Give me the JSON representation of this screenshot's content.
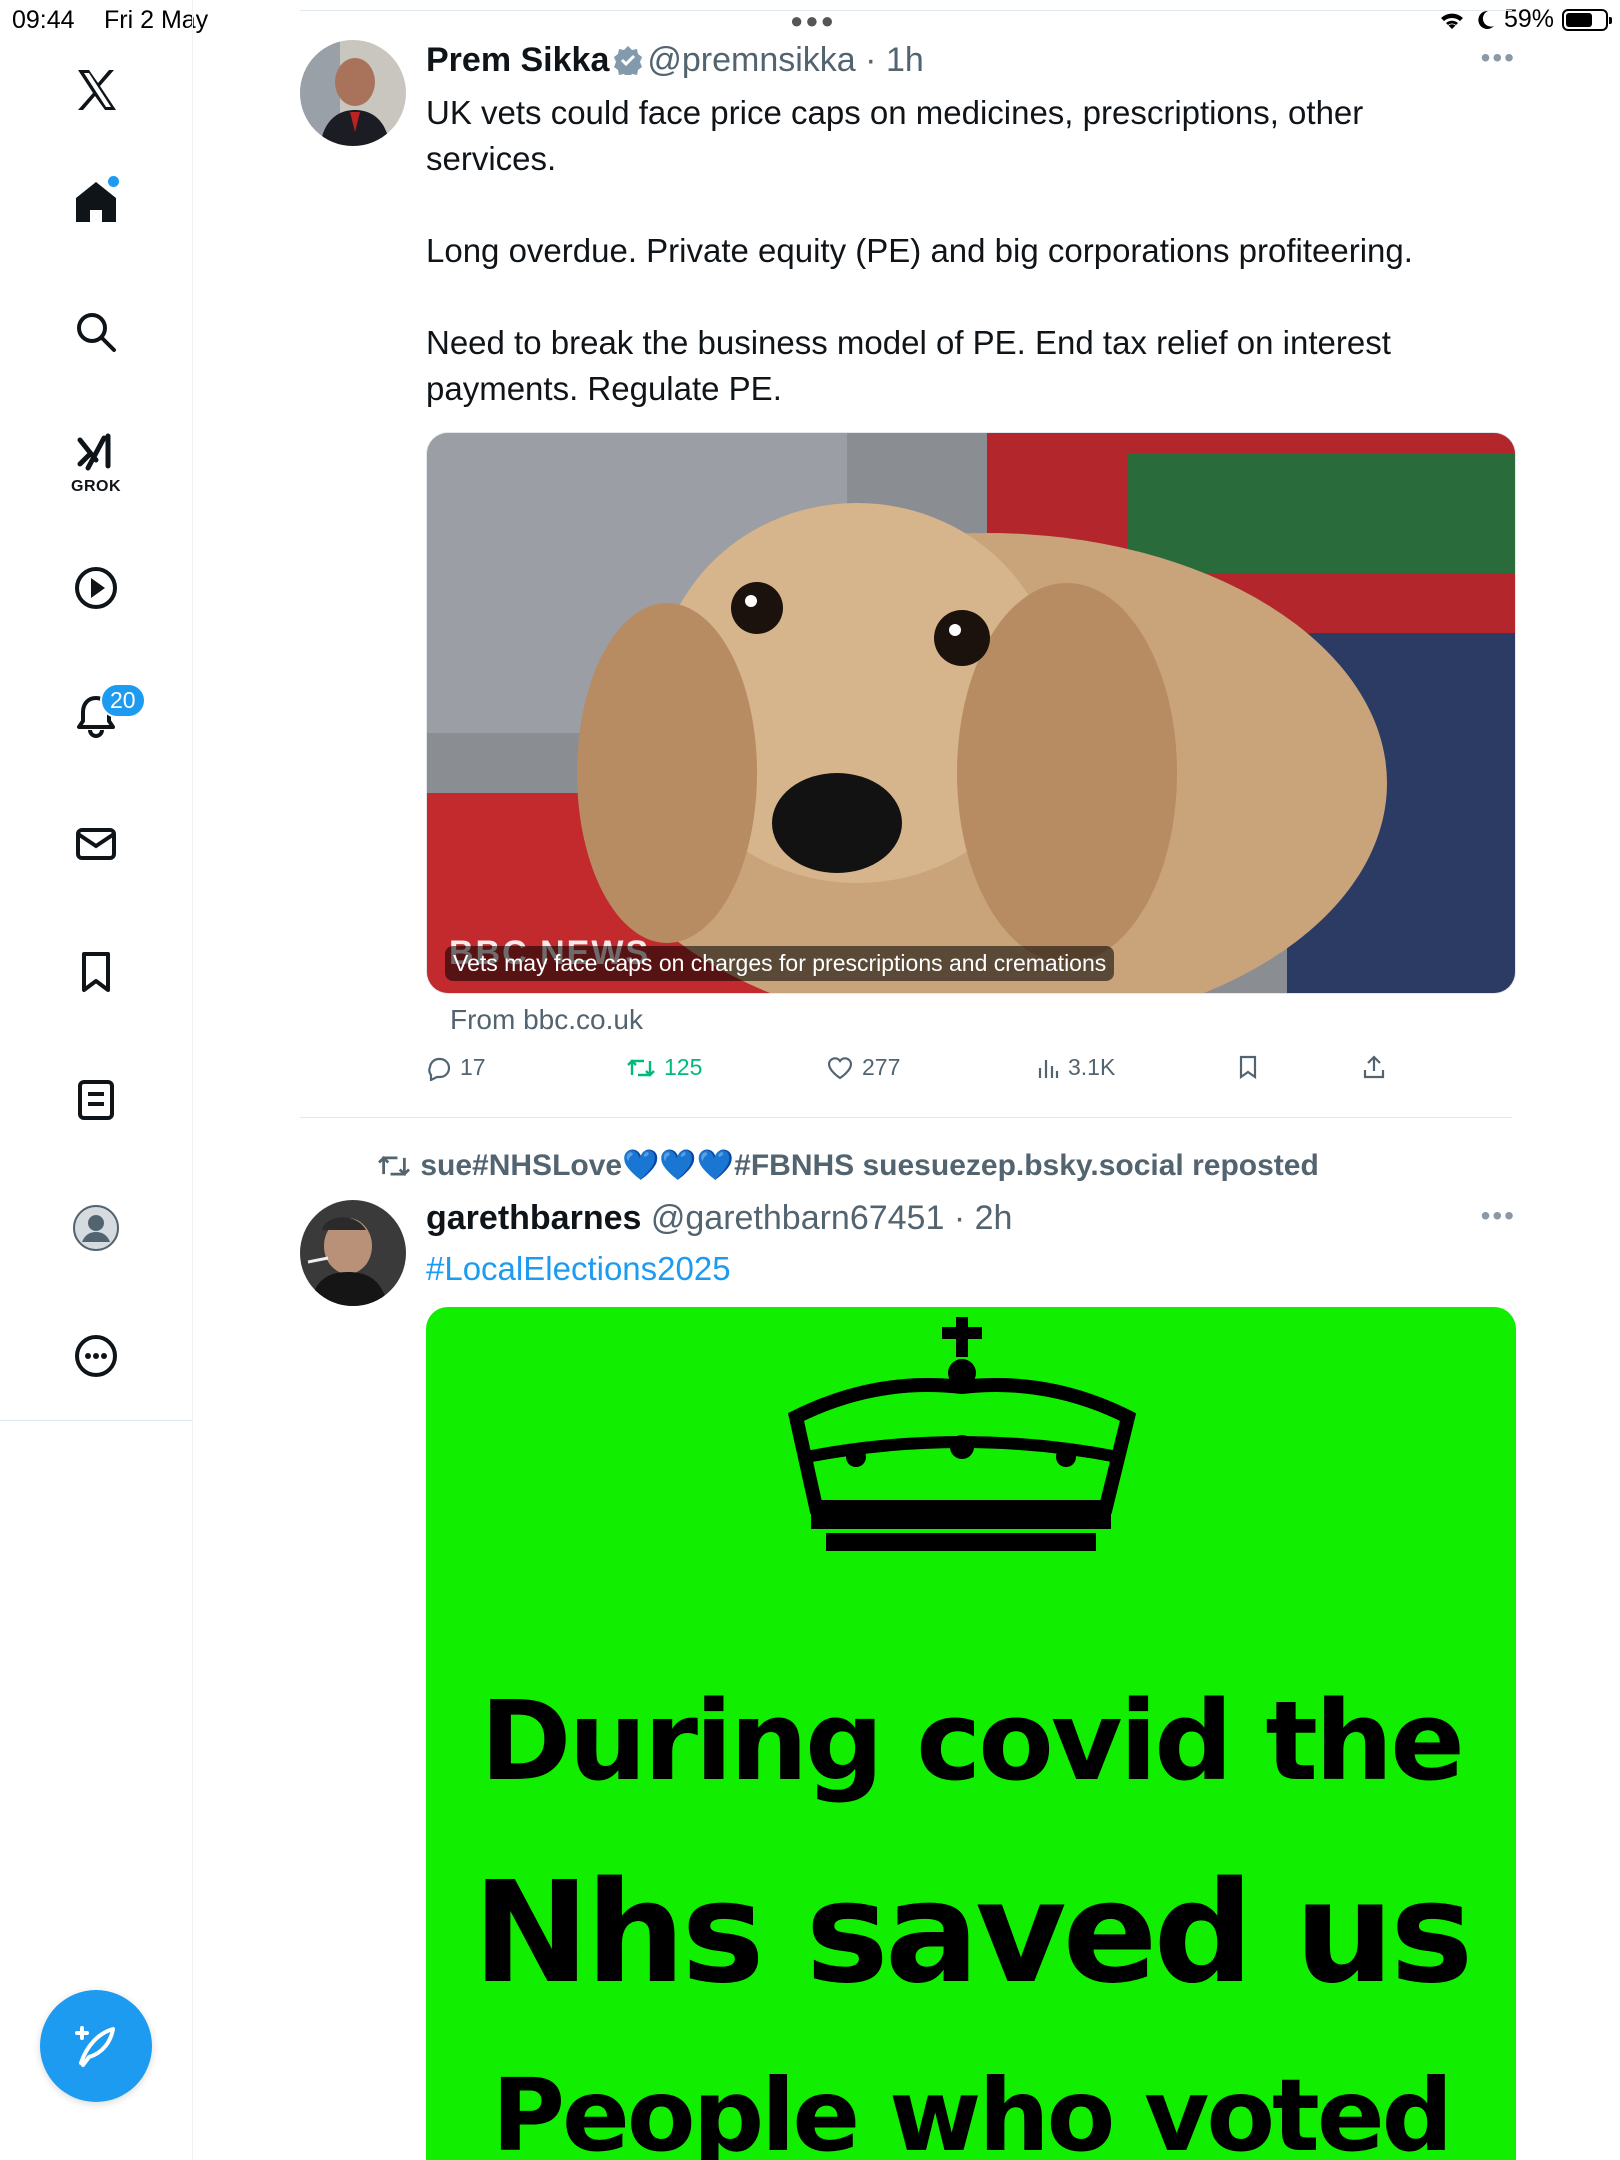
{
  "status": {
    "time": "09:44",
    "date": "Fri 2 May",
    "battery": "59%",
    "battery_level": 0.59
  },
  "sidebar": {
    "items": [
      {
        "name": "logo",
        "icon": "x-logo-icon"
      },
      {
        "name": "home",
        "icon": "home-icon"
      },
      {
        "name": "explore",
        "icon": "search-icon"
      },
      {
        "name": "grok",
        "icon": "grok-icon",
        "label": "GROK"
      },
      {
        "name": "videos",
        "icon": "play-icon"
      },
      {
        "name": "notifications",
        "icon": "bell-icon",
        "badge": "20"
      },
      {
        "name": "messages",
        "icon": "mail-icon"
      },
      {
        "name": "bookmarks",
        "icon": "bookmark-icon"
      },
      {
        "name": "lists",
        "icon": "list-icon"
      },
      {
        "name": "profile",
        "icon": "profile-icon"
      },
      {
        "name": "more",
        "icon": "more-circle-icon"
      }
    ],
    "compose_icon": "compose-feather-icon"
  },
  "tweets": [
    {
      "name": "Prem Sikka",
      "handle": "@premnsikka",
      "time": "· 1h",
      "text": "UK vets could face price caps on medicines, prescriptions, other services.\n\nLong overdue. Private equity (PE) and big corporations profiteering.\n\nNeed to break the business model of PE. End tax relief on interest payments. Regulate PE.",
      "card": {
        "caption": "Vets may face caps on charges for prescriptions and cremations",
        "watermark": "BBC NEWS",
        "source": "From bbc.co.uk"
      },
      "stats": {
        "replies": "17",
        "reposts": "125",
        "likes": "277",
        "views": "3.1K"
      }
    },
    {
      "reposted_by": "sue#NHSLove💙💙💙#FBNHS suesuezep.bsky.social reposted",
      "name": "garethbarnes",
      "handle": "@garethbarn67451",
      "time": "· 2h",
      "hashtag": "#LocalElections2025",
      "image_lines": [
        "During covid the",
        "Nhs saved us",
        "People who voted"
      ]
    }
  ],
  "colors": {
    "accent": "#1d9bf0",
    "repost": "#00ba7c",
    "meme_green": "#11ee00"
  }
}
